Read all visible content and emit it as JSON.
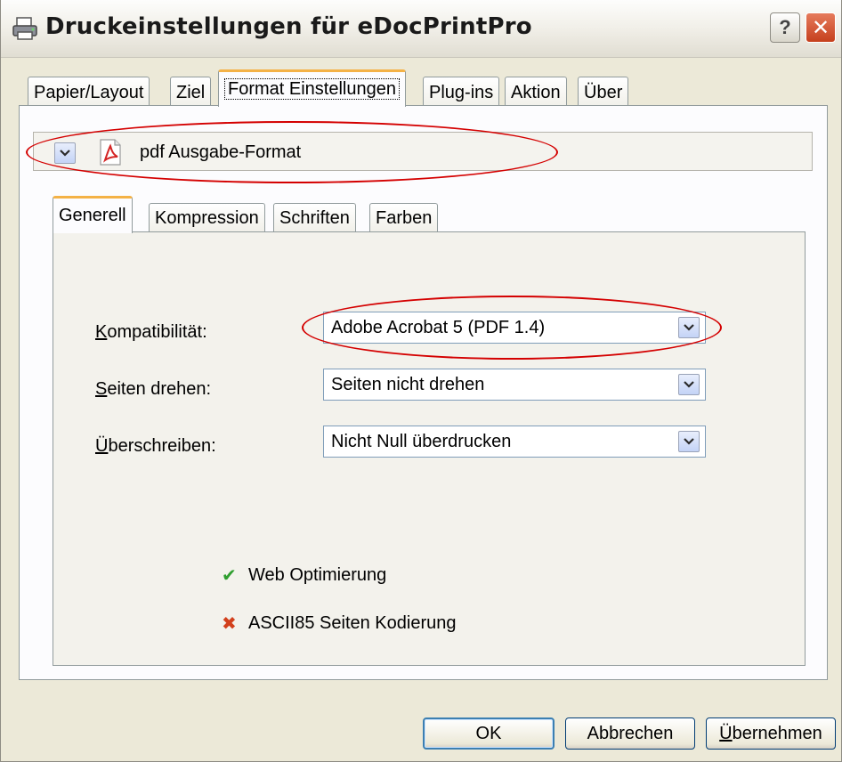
{
  "window": {
    "title": "Druckeinstellungen für eDocPrintPro"
  },
  "titlebar": {
    "help": "?",
    "close": "✕"
  },
  "tabs": [
    {
      "label": "Papier/Layout"
    },
    {
      "label": "Ziel"
    },
    {
      "label": "Format Einstellungen"
    },
    {
      "label": "Plug-ins"
    },
    {
      "label": "Aktion"
    },
    {
      "label": "Über"
    }
  ],
  "format": {
    "selected": "pdf Ausgabe-Format",
    "icon": "pdf-icon"
  },
  "subtabs": [
    {
      "label": "Generell"
    },
    {
      "label": "Kompression"
    },
    {
      "label": "Schriften"
    },
    {
      "label": "Farben"
    }
  ],
  "fields": {
    "compat": {
      "label_access": "K",
      "label_rest": "ompatibilität:",
      "value": "Adobe Acrobat 5 (PDF 1.4)"
    },
    "rotate": {
      "label_access": "S",
      "label_rest": "eiten drehen:",
      "value": "Seiten nicht drehen"
    },
    "overprint": {
      "label_access": "Ü",
      "label_rest": "berschreiben:",
      "value": "Nicht Null überdrucken"
    }
  },
  "options": [
    {
      "label": "Web Optimierung",
      "state": "on",
      "mark": "✔",
      "color": "#2e9e2e"
    },
    {
      "label": "ASCII85 Seiten Kodierung",
      "state": "off",
      "mark": "✖",
      "color": "#d2401c"
    }
  ],
  "buttons": {
    "ok": "OK",
    "cancel": "Abbrechen",
    "apply_access": "Ü",
    "apply_rest": "bernehmen"
  },
  "colors": {
    "highlight_ellipse": "#d40000",
    "active_tab_accent": "#f4b246",
    "window_bg": "#ece9d8"
  }
}
